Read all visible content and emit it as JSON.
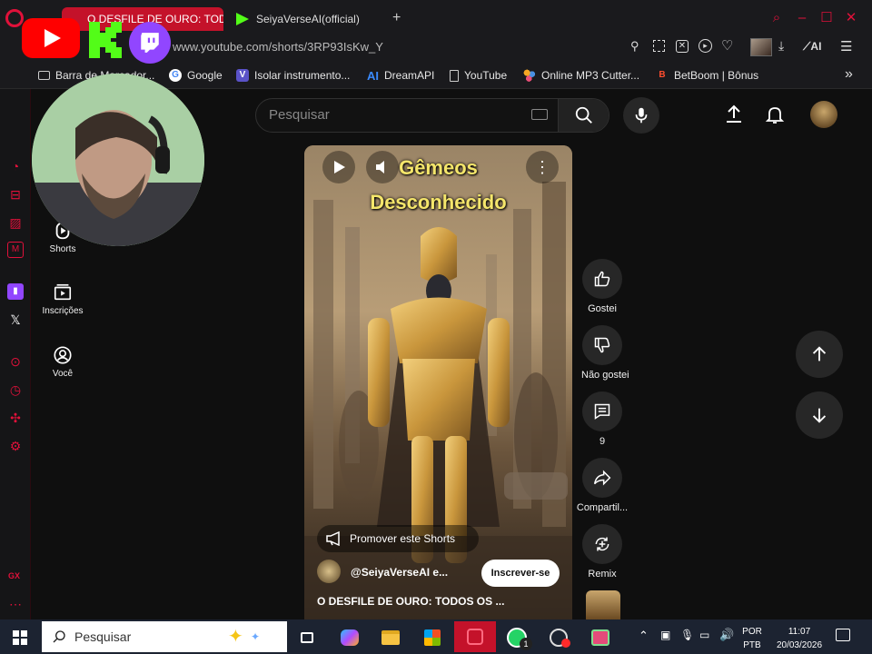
{
  "browser": {
    "active_tab": "O DESFILE DE OURO: TOD",
    "inactive_tab": "SeiyaVerseAI(official)",
    "new_tab": "+",
    "url": "www.youtube.com/shorts/3RP93IsKw_Y",
    "ai_label": "AI",
    "bookmarks": [
      {
        "label": "Barra de Marcador...",
        "icon": "folder-icon"
      },
      {
        "label": "Google",
        "icon": "google-icon"
      },
      {
        "label": "Isolar instrumento...",
        "icon": "vocal-remover-icon"
      },
      {
        "label": "DreamAPI",
        "icon": "ai-icon"
      },
      {
        "label": "YouTube",
        "icon": "page-icon"
      },
      {
        "label": "Online MP3 Cutter...",
        "icon": "mp3-cutter-icon"
      },
      {
        "label": "BetBoom | Bônus",
        "icon": "betboom-icon"
      }
    ]
  },
  "youtube": {
    "search_placeholder": "Pesquisar",
    "nav": [
      {
        "label": "Shorts"
      },
      {
        "label": "Inscrições"
      },
      {
        "label": "Você"
      }
    ],
    "video": {
      "overlay_title_line1": "Gêmeos",
      "overlay_title_line2": "Desconhecido",
      "promote_label": "Promover este Shorts",
      "channel": "@SeiyaVerseAI e...",
      "subscribe_label": "Inscrever-se",
      "title": "O DESFILE DE OURO: TODOS OS ..."
    },
    "actions": [
      {
        "label": "Gostei"
      },
      {
        "label": "Não gostei"
      },
      {
        "label": "9"
      },
      {
        "label": "Compartil..."
      },
      {
        "label": "Remix"
      }
    ]
  },
  "sidebar": {
    "gx_label": "GX"
  },
  "taskbar": {
    "search_placeholder": "Pesquisar",
    "language": "POR",
    "layout": "PTB",
    "time": "11:07",
    "date": "20/03/2026",
    "whatsapp_badge": "1"
  },
  "colors": {
    "opera_accent": "#e0113a",
    "youtube_red": "#ff0000",
    "kick_green": "#53fc18",
    "twitch_purple": "#9146ff"
  }
}
